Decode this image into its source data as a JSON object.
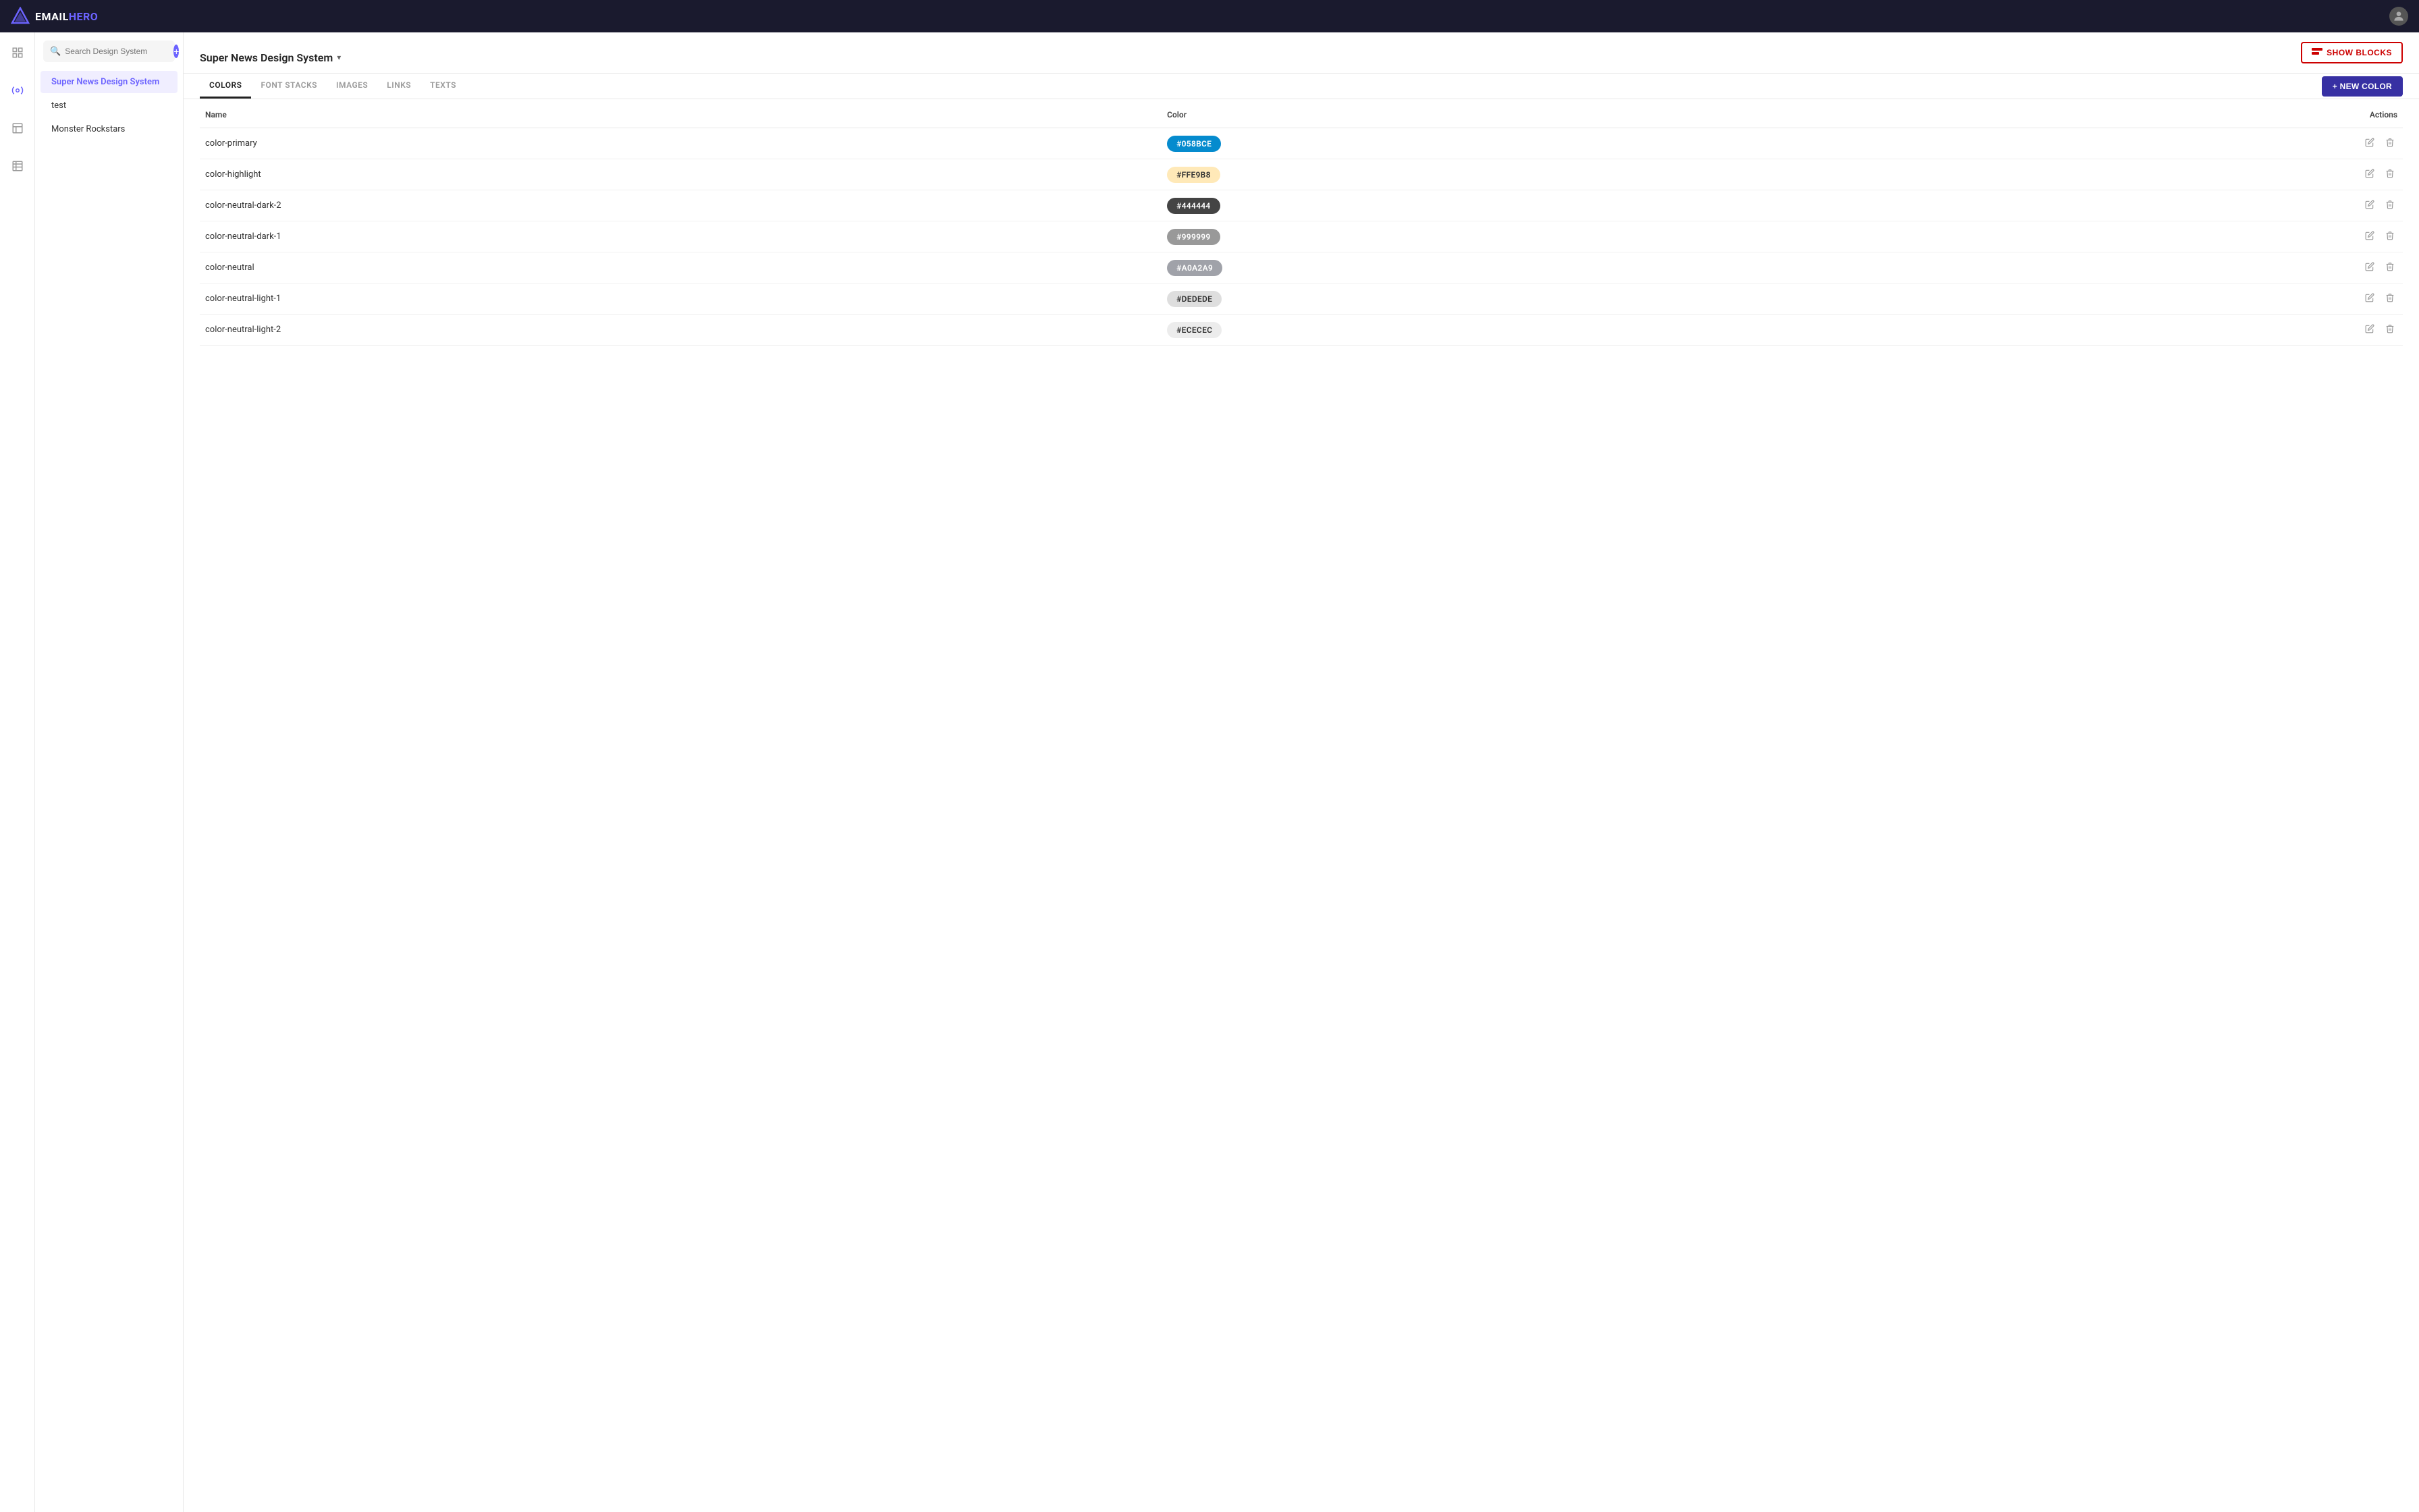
{
  "app": {
    "logo_email": "EMAIL",
    "logo_hero": "HERO"
  },
  "topnav": {
    "title": "EMAILHERO"
  },
  "sidebar": {
    "search_placeholder": "Search Design System",
    "items": [
      {
        "id": "super-news",
        "label": "Super News Design System",
        "active": true
      },
      {
        "id": "test",
        "label": "test",
        "active": false
      },
      {
        "id": "monster",
        "label": "Monster Rockstars",
        "active": false
      }
    ]
  },
  "header": {
    "title": "Super News Design System",
    "dropdown_arrow": "▾",
    "show_blocks_label": "SHOW BLOCKS",
    "new_color_label": "+ NEW COLOR"
  },
  "tabs": [
    {
      "id": "colors",
      "label": "COLORS",
      "active": true
    },
    {
      "id": "font-stacks",
      "label": "FONT STACKS",
      "active": false
    },
    {
      "id": "images",
      "label": "IMAGES",
      "active": false
    },
    {
      "id": "links",
      "label": "LINKS",
      "active": false
    },
    {
      "id": "texts",
      "label": "TEXTS",
      "active": false
    }
  ],
  "table": {
    "columns": [
      {
        "id": "name",
        "label": "Name"
      },
      {
        "id": "color",
        "label": "Color"
      },
      {
        "id": "actions",
        "label": "Actions"
      }
    ],
    "rows": [
      {
        "name": "color-primary",
        "hex": "#058BCE",
        "badge_bg": "#058BCE",
        "badge_text": "#ffffff"
      },
      {
        "name": "color-highlight",
        "hex": "#FFE9B8",
        "badge_bg": "#FFE9B8",
        "badge_text": "#333333"
      },
      {
        "name": "color-neutral-dark-2",
        "hex": "#444444",
        "badge_bg": "#444444",
        "badge_text": "#ffffff"
      },
      {
        "name": "color-neutral-dark-1",
        "hex": "#999999",
        "badge_bg": "#999999",
        "badge_text": "#ffffff"
      },
      {
        "name": "color-neutral",
        "hex": "#A0A2A9",
        "badge_bg": "#A0A2A9",
        "badge_text": "#ffffff"
      },
      {
        "name": "color-neutral-light-1",
        "hex": "#DEDEDE",
        "badge_bg": "#DEDEDE",
        "badge_text": "#333333"
      },
      {
        "name": "color-neutral-light-2",
        "hex": "#ECECEC",
        "badge_bg": "#ECECEC",
        "badge_text": "#333333"
      }
    ]
  }
}
